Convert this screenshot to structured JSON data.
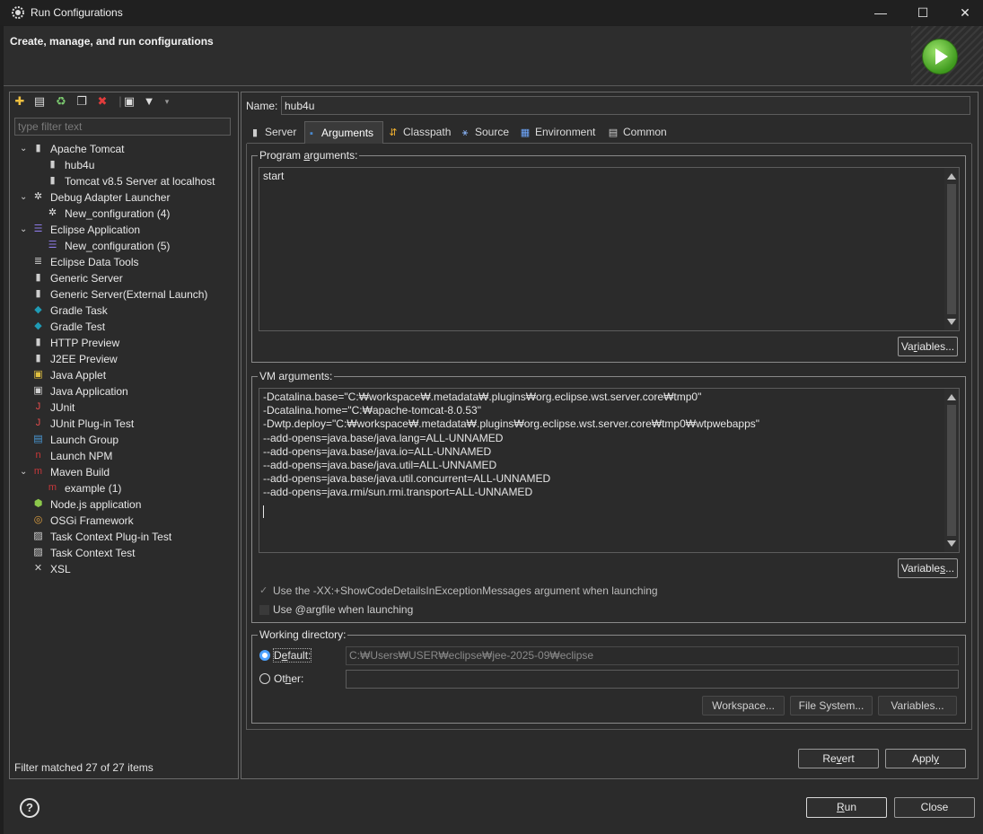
{
  "window": {
    "title": "Run Configurations",
    "minimize": "—",
    "maximize": "☐",
    "close": "✕"
  },
  "banner": {
    "title": "Create, manage, and run configurations"
  },
  "filter": {
    "placeholder": "type filter text"
  },
  "tree": [
    {
      "label": "Apache Tomcat",
      "level": 0,
      "expanded": true,
      "icon": "server-icon"
    },
    {
      "label": "hub4u",
      "level": 1,
      "icon": "server-icon"
    },
    {
      "label": "Tomcat v8.5 Server at localhost",
      "level": 1,
      "icon": "server-icon"
    },
    {
      "label": "Debug Adapter Launcher",
      "level": 0,
      "expanded": true,
      "icon": "bug-gear-icon"
    },
    {
      "label": "New_configuration (4)",
      "level": 1,
      "icon": "bug-gear-icon"
    },
    {
      "label": "Eclipse Application",
      "level": 0,
      "expanded": true,
      "icon": "eclipse-icon"
    },
    {
      "label": "New_configuration (5)",
      "level": 1,
      "icon": "eclipse-icon"
    },
    {
      "label": "Eclipse Data Tools",
      "level": 0,
      "icon": "database-icon"
    },
    {
      "label": "Generic Server",
      "level": 0,
      "icon": "server-icon"
    },
    {
      "label": "Generic Server(External Launch)",
      "level": 0,
      "icon": "server-icon"
    },
    {
      "label": "Gradle Task",
      "level": 0,
      "icon": "gradle-icon"
    },
    {
      "label": "Gradle Test",
      "level": 0,
      "icon": "gradle-icon"
    },
    {
      "label": "HTTP Preview",
      "level": 0,
      "icon": "server-icon"
    },
    {
      "label": "J2EE Preview",
      "level": 0,
      "icon": "server-icon"
    },
    {
      "label": "Java Applet",
      "level": 0,
      "icon": "applet-icon"
    },
    {
      "label": "Java Application",
      "level": 0,
      "icon": "java-app-icon"
    },
    {
      "label": "JUnit",
      "level": 0,
      "icon": "junit-icon"
    },
    {
      "label": "JUnit Plug-in Test",
      "level": 0,
      "icon": "junit-plugin-icon"
    },
    {
      "label": "Launch Group",
      "level": 0,
      "icon": "launch-group-icon"
    },
    {
      "label": "Launch NPM",
      "level": 0,
      "icon": "npm-icon"
    },
    {
      "label": "Maven Build",
      "level": 0,
      "expanded": true,
      "icon": "maven-icon"
    },
    {
      "label": "example (1)",
      "level": 1,
      "icon": "maven-icon"
    },
    {
      "label": "Node.js application",
      "level": 0,
      "icon": "nodejs-icon"
    },
    {
      "label": "OSGi Framework",
      "level": 0,
      "icon": "osgi-icon"
    },
    {
      "label": "Task Context Plug-in Test",
      "level": 0,
      "icon": "task-plugin-test-icon"
    },
    {
      "label": "Task Context Test",
      "level": 0,
      "icon": "task-test-icon"
    },
    {
      "label": "XSL",
      "level": 0,
      "icon": "xsl-icon"
    }
  ],
  "filter_status": "Filter matched 27 of 27 items",
  "name": {
    "label": "Name:",
    "value": "hub4u"
  },
  "tabs": [
    "Server",
    "Arguments",
    "Classpath",
    "Source",
    "Environment",
    "Common"
  ],
  "program_args": {
    "label": "Program arguments:",
    "value": "start",
    "variables": "Variables..."
  },
  "vm_args": {
    "label": "VM arguments:",
    "lines": [
      "-Dcatalina.base=\"C:₩workspace₩.metadata₩.plugins₩org.eclipse.wst.server.core₩tmp0\"",
      "-Dcatalina.home=\"C:₩apache-tomcat-8.0.53\"",
      "-Dwtp.deploy=\"C:₩workspace₩.metadata₩.plugins₩org.eclipse.wst.server.core₩tmp0₩wtpwebapps\"",
      "--add-opens=java.base/java.lang=ALL-UNNAMED",
      "--add-opens=java.base/java.io=ALL-UNNAMED",
      "--add-opens=java.base/java.util=ALL-UNNAMED",
      "--add-opens=java.base/java.util.concurrent=ALL-UNNAMED",
      "--add-opens=java.rmi/sun.rmi.transport=ALL-UNNAMED"
    ],
    "variables": "Variables...",
    "show_code_details": "Use the -XX:+ShowCodeDetailsInExceptionMessages argument when launching",
    "argfile": "Use @argfile when launching"
  },
  "working_dir": {
    "label": "Working directory:",
    "default_label": "Default:",
    "default_value": "C:₩Users₩USER₩eclipse₩jee-2025-09₩eclipse",
    "other_label": "Other:",
    "other_value": "",
    "workspace": "Workspace...",
    "file_system": "File System...",
    "variables": "Variables..."
  },
  "buttons": {
    "revert": "Revert",
    "apply": "Apply",
    "run": "Run",
    "close": "Close"
  },
  "colors": {
    "accent": "#4ea3ff",
    "background": "#2b2b2b",
    "border": "#6a6a6a"
  }
}
